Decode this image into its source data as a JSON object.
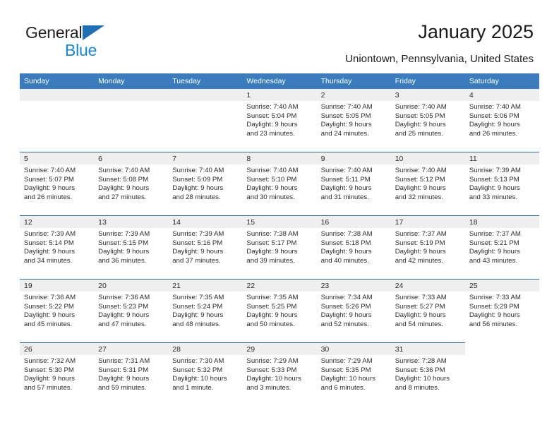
{
  "brand": {
    "name_part1": "General",
    "name_part2": "Blue",
    "triangle_color": "#1f6fb4",
    "blue_color": "#1a84d6"
  },
  "header": {
    "title": "January 2025",
    "subtitle": "Uniontown, Pennsylvania, United States",
    "header_bg": "#3a7cbe",
    "row_divider": "#2f6da8",
    "daynum_bg": "#efefef"
  },
  "weekday_headers": [
    "Sunday",
    "Monday",
    "Tuesday",
    "Wednesday",
    "Thursday",
    "Friday",
    "Saturday"
  ],
  "weeks": [
    [
      {
        "day": "",
        "blank": true,
        "lines": []
      },
      {
        "day": "",
        "blank": true,
        "lines": []
      },
      {
        "day": "",
        "blank": true,
        "lines": []
      },
      {
        "day": "1",
        "lines": [
          "Sunrise: 7:40 AM",
          "Sunset: 5:04 PM",
          "Daylight: 9 hours",
          "and 23 minutes."
        ]
      },
      {
        "day": "2",
        "lines": [
          "Sunrise: 7:40 AM",
          "Sunset: 5:05 PM",
          "Daylight: 9 hours",
          "and 24 minutes."
        ]
      },
      {
        "day": "3",
        "lines": [
          "Sunrise: 7:40 AM",
          "Sunset: 5:05 PM",
          "Daylight: 9 hours",
          "and 25 minutes."
        ]
      },
      {
        "day": "4",
        "lines": [
          "Sunrise: 7:40 AM",
          "Sunset: 5:06 PM",
          "Daylight: 9 hours",
          "and 26 minutes."
        ]
      }
    ],
    [
      {
        "day": "5",
        "lines": [
          "Sunrise: 7:40 AM",
          "Sunset: 5:07 PM",
          "Daylight: 9 hours",
          "and 26 minutes."
        ]
      },
      {
        "day": "6",
        "lines": [
          "Sunrise: 7:40 AM",
          "Sunset: 5:08 PM",
          "Daylight: 9 hours",
          "and 27 minutes."
        ]
      },
      {
        "day": "7",
        "lines": [
          "Sunrise: 7:40 AM",
          "Sunset: 5:09 PM",
          "Daylight: 9 hours",
          "and 28 minutes."
        ]
      },
      {
        "day": "8",
        "lines": [
          "Sunrise: 7:40 AM",
          "Sunset: 5:10 PM",
          "Daylight: 9 hours",
          "and 30 minutes."
        ]
      },
      {
        "day": "9",
        "lines": [
          "Sunrise: 7:40 AM",
          "Sunset: 5:11 PM",
          "Daylight: 9 hours",
          "and 31 minutes."
        ]
      },
      {
        "day": "10",
        "lines": [
          "Sunrise: 7:40 AM",
          "Sunset: 5:12 PM",
          "Daylight: 9 hours",
          "and 32 minutes."
        ]
      },
      {
        "day": "11",
        "lines": [
          "Sunrise: 7:39 AM",
          "Sunset: 5:13 PM",
          "Daylight: 9 hours",
          "and 33 minutes."
        ]
      }
    ],
    [
      {
        "day": "12",
        "lines": [
          "Sunrise: 7:39 AM",
          "Sunset: 5:14 PM",
          "Daylight: 9 hours",
          "and 34 minutes."
        ]
      },
      {
        "day": "13",
        "lines": [
          "Sunrise: 7:39 AM",
          "Sunset: 5:15 PM",
          "Daylight: 9 hours",
          "and 36 minutes."
        ]
      },
      {
        "day": "14",
        "lines": [
          "Sunrise: 7:39 AM",
          "Sunset: 5:16 PM",
          "Daylight: 9 hours",
          "and 37 minutes."
        ]
      },
      {
        "day": "15",
        "lines": [
          "Sunrise: 7:38 AM",
          "Sunset: 5:17 PM",
          "Daylight: 9 hours",
          "and 39 minutes."
        ]
      },
      {
        "day": "16",
        "lines": [
          "Sunrise: 7:38 AM",
          "Sunset: 5:18 PM",
          "Daylight: 9 hours",
          "and 40 minutes."
        ]
      },
      {
        "day": "17",
        "lines": [
          "Sunrise: 7:37 AM",
          "Sunset: 5:19 PM",
          "Daylight: 9 hours",
          "and 42 minutes."
        ]
      },
      {
        "day": "18",
        "lines": [
          "Sunrise: 7:37 AM",
          "Sunset: 5:21 PM",
          "Daylight: 9 hours",
          "and 43 minutes."
        ]
      }
    ],
    [
      {
        "day": "19",
        "lines": [
          "Sunrise: 7:36 AM",
          "Sunset: 5:22 PM",
          "Daylight: 9 hours",
          "and 45 minutes."
        ]
      },
      {
        "day": "20",
        "lines": [
          "Sunrise: 7:36 AM",
          "Sunset: 5:23 PM",
          "Daylight: 9 hours",
          "and 47 minutes."
        ]
      },
      {
        "day": "21",
        "lines": [
          "Sunrise: 7:35 AM",
          "Sunset: 5:24 PM",
          "Daylight: 9 hours",
          "and 48 minutes."
        ]
      },
      {
        "day": "22",
        "lines": [
          "Sunrise: 7:35 AM",
          "Sunset: 5:25 PM",
          "Daylight: 9 hours",
          "and 50 minutes."
        ]
      },
      {
        "day": "23",
        "lines": [
          "Sunrise: 7:34 AM",
          "Sunset: 5:26 PM",
          "Daylight: 9 hours",
          "and 52 minutes."
        ]
      },
      {
        "day": "24",
        "lines": [
          "Sunrise: 7:33 AM",
          "Sunset: 5:27 PM",
          "Daylight: 9 hours",
          "and 54 minutes."
        ]
      },
      {
        "day": "25",
        "lines": [
          "Sunrise: 7:33 AM",
          "Sunset: 5:29 PM",
          "Daylight: 9 hours",
          "and 56 minutes."
        ]
      }
    ],
    [
      {
        "day": "26",
        "lines": [
          "Sunrise: 7:32 AM",
          "Sunset: 5:30 PM",
          "Daylight: 9 hours",
          "and 57 minutes."
        ]
      },
      {
        "day": "27",
        "lines": [
          "Sunrise: 7:31 AM",
          "Sunset: 5:31 PM",
          "Daylight: 9 hours",
          "and 59 minutes."
        ]
      },
      {
        "day": "28",
        "lines": [
          "Sunrise: 7:30 AM",
          "Sunset: 5:32 PM",
          "Daylight: 10 hours",
          "and 1 minute."
        ]
      },
      {
        "day": "29",
        "lines": [
          "Sunrise: 7:29 AM",
          "Sunset: 5:33 PM",
          "Daylight: 10 hours",
          "and 3 minutes."
        ]
      },
      {
        "day": "30",
        "lines": [
          "Sunrise: 7:29 AM",
          "Sunset: 5:35 PM",
          "Daylight: 10 hours",
          "and 6 minutes."
        ]
      },
      {
        "day": "31",
        "lines": [
          "Sunrise: 7:28 AM",
          "Sunset: 5:36 PM",
          "Daylight: 10 hours",
          "and 8 minutes."
        ]
      },
      {
        "day": "",
        "none": true,
        "lines": []
      }
    ]
  ]
}
